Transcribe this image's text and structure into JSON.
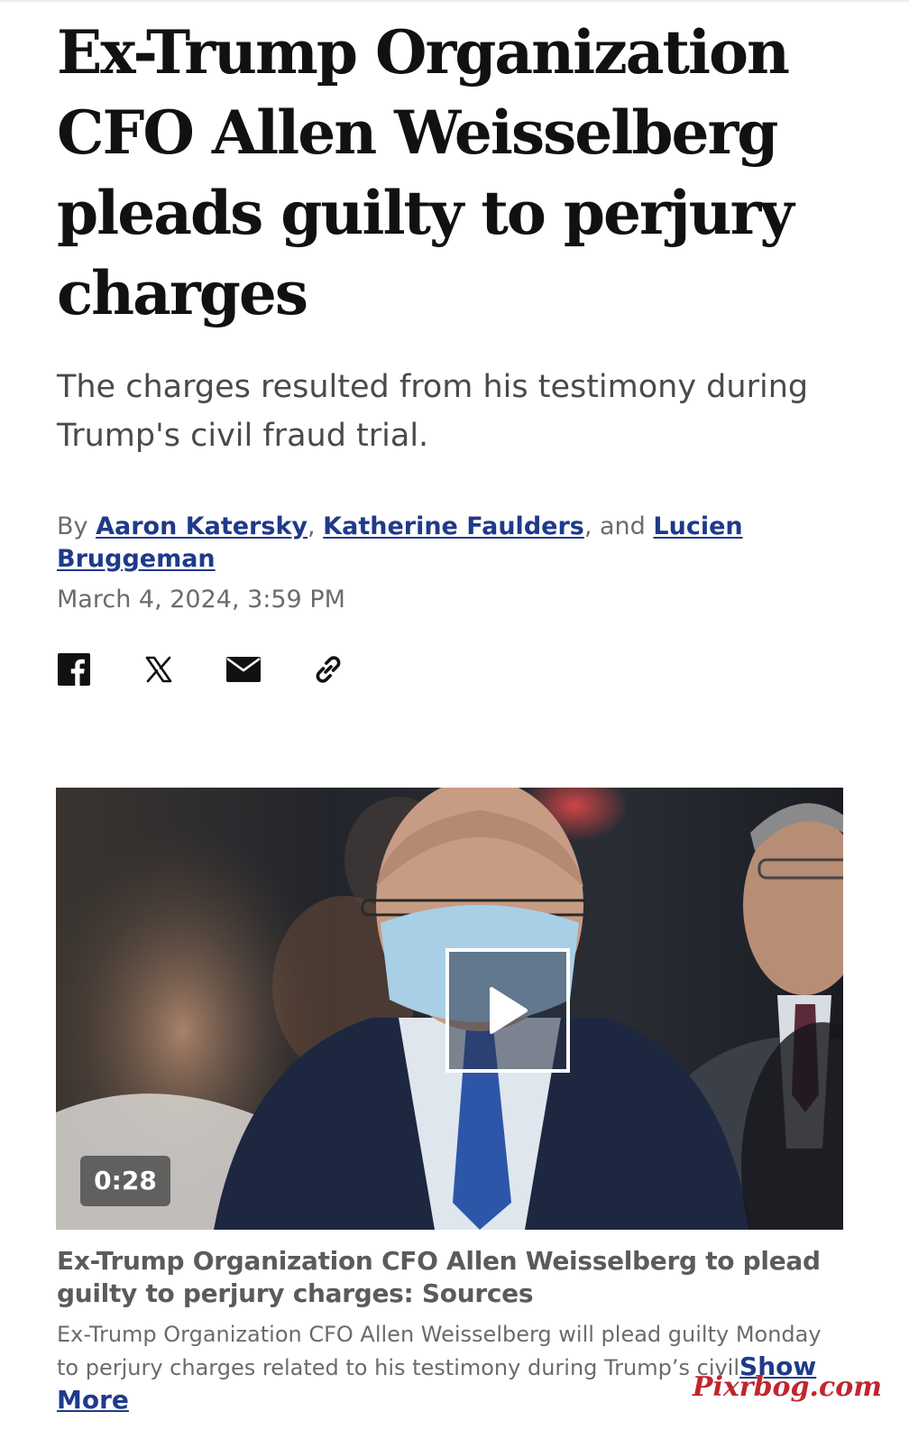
{
  "article": {
    "headline": "Ex-Trump Organization CFO Allen Weisselberg pleads guilty to perjury charges",
    "subheadline": "The charges resulted from his testimony during Trump's civil fraud trial.",
    "byline": {
      "prefix": "By ",
      "authors": [
        "Aaron Katersky",
        "Katherine Faulders",
        "Lucien Bruggeman"
      ],
      "sep1": ", ",
      "sep2": ", and "
    },
    "date": "March 4, 2024, 3:59 PM"
  },
  "share": {
    "icons": [
      "facebook-icon",
      "x-icon",
      "email-icon",
      "link-icon"
    ]
  },
  "video": {
    "duration": "0:28",
    "title": "Ex-Trump Organization CFO Allen Weisselberg to plead guilty to perjury charges: Sources",
    "description": "Ex-Trump Organization CFO Allen Weisselberg will plead guilty Monday to perjury charges related to his testimony during Trump’s civil",
    "show_more": "Show More"
  },
  "watermark": "Pixrbog.com",
  "colors": {
    "link": "#1f3a8a",
    "text": "#111111",
    "muted": "#6b6b6b",
    "watermark": "#c0262d"
  }
}
